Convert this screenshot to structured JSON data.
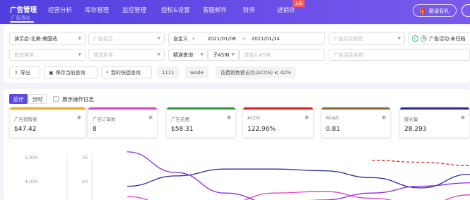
{
  "colors": {
    "nav_bg": "#5b4be0",
    "accent": "#5b4be0",
    "green": "#2fb36c"
  },
  "nav": {
    "active_label": "广告管理",
    "active_sub": "广告活动",
    "items": [
      "经营分析",
      "库存管理",
      "监控管理",
      "授权&设置",
      "客服邮件",
      "财务",
      "进销存"
    ],
    "badge": "上新",
    "invite_label": "邀请有礼"
  },
  "filters": {
    "store": "演示店-北美-美国站",
    "ad_group_placeholder": "广告组合",
    "date_mode": "自定义",
    "date_start": "2021/01/08",
    "date_end": "2021/01/14",
    "campaign_type_placeholder": "广告活动类型",
    "status_label": "广告活动:未归档",
    "delivery_type_placeholder": "投放类型",
    "filter_condition_placeholder": "筛选条件",
    "search_mode": "精准查询",
    "search_field": "子ASIN",
    "search_placeholder": "请输入ASIN",
    "campaign_name_placeholder": "广告活动名称"
  },
  "actions": {
    "export_label": "导出",
    "save_query_label": "保存当前查询",
    "my_queries_label": "我的快捷查询",
    "chips": [
      "1111",
      "wode",
      "花费销售额占比(ACOS) ≤ 42%"
    ]
  },
  "view": {
    "total_label": "总计",
    "by_time_label": "分时",
    "show_log_label": "展示操作日志"
  },
  "metrics": [
    {
      "title": "广告销售额",
      "value": "$47.42",
      "color": "#f5a623"
    },
    {
      "title": "广告订单数",
      "value": "8",
      "color": "#e040c8"
    },
    {
      "title": "广告花费",
      "value": "$58.31",
      "color": "#2e9b3a"
    },
    {
      "title": "ACOS",
      "value": "122.96%",
      "color": "#e02020"
    },
    {
      "title": "ROAS",
      "value": "0.81",
      "color": "#8a6a3a"
    },
    {
      "title": "曝光量",
      "value": "28,293",
      "color": "#2a2a9a"
    }
  ],
  "chart_data": {
    "type": "line",
    "y_left_ticks": [
      "5,000",
      "4,000"
    ],
    "y_right_ticks": [
      "25",
      "20"
    ],
    "series": [
      {
        "color": "#2a2a9a",
        "values": [
          4.0,
          4.6,
          5.0,
          5.0,
          4.9,
          4.5,
          3.9,
          4.7
        ]
      },
      {
        "color": "#e040c8",
        "values": [
          3.4,
          2.8,
          3.0,
          3.6,
          3.7,
          3.3,
          2.9,
          3.5
        ]
      },
      {
        "color": "#8a2be2",
        "values": [
          6.0,
          4.8,
          3.6,
          3.0,
          3.2,
          3.6,
          4.0,
          4.2
        ]
      },
      {
        "color": "#e02020",
        "dashed": true,
        "values": [
          null,
          null,
          null,
          null,
          null,
          5.5,
          5.4,
          5.2
        ]
      }
    ]
  }
}
